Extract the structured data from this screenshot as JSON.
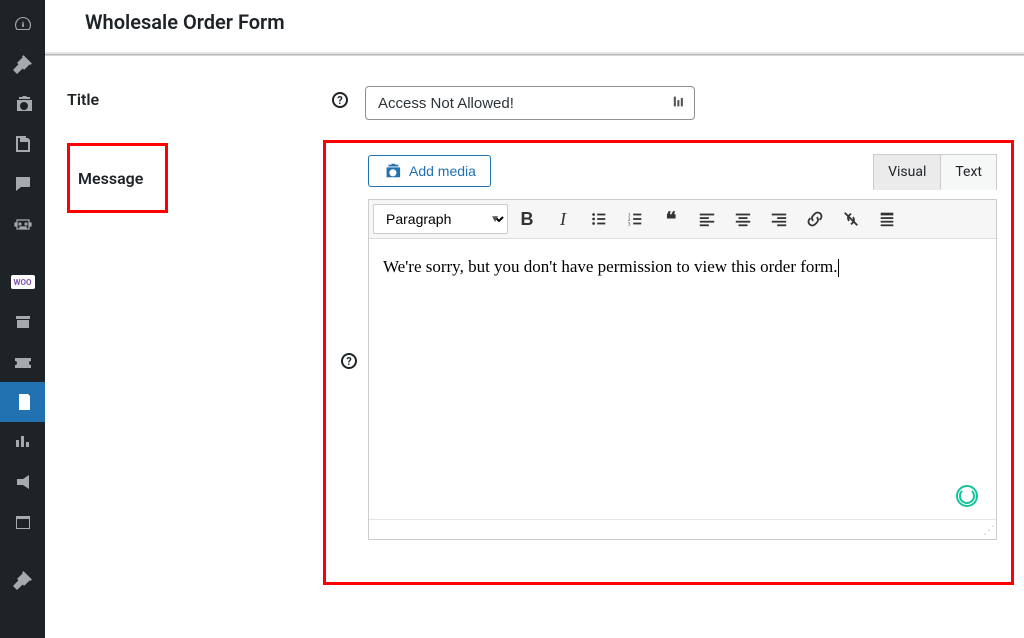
{
  "header": {
    "page_title": "Wholesale Order Form"
  },
  "fields": {
    "title_label": "Title",
    "title_value": "Access Not Allowed!",
    "message_label": "Message"
  },
  "editor": {
    "add_media_label": "Add media",
    "tabs": {
      "visual": "Visual",
      "text": "Text"
    },
    "format_selected": "Paragraph",
    "content": "We're sorry, but you don't have permission to view this order form."
  },
  "sidebar": {
    "woo_badge": "WOO"
  }
}
